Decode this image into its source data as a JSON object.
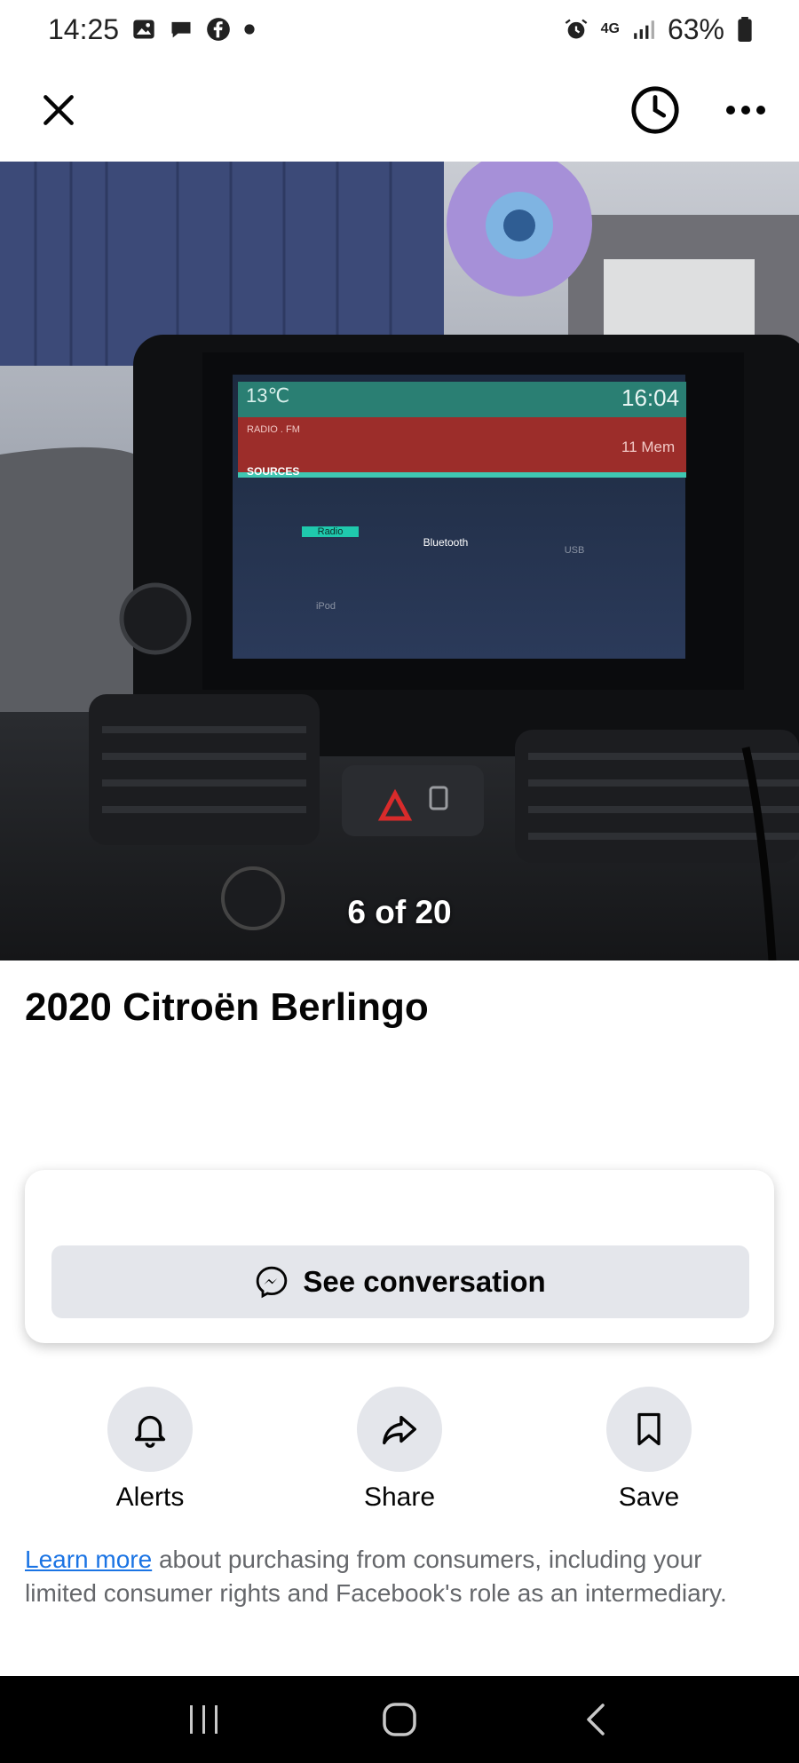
{
  "status_bar": {
    "time": "14:25",
    "network": "4G",
    "battery": "63%",
    "left_icons": [
      "gallery-icon",
      "messages-icon",
      "facebook-icon",
      "dot-icon"
    ],
    "right_icons": [
      "alarm-icon",
      "signal-icon",
      "battery-icon"
    ]
  },
  "app_bar": {
    "close_icon": "close-icon",
    "history_icon": "clock-icon",
    "more_icon": "more-icon"
  },
  "photo": {
    "counter": "6 of 20",
    "screen": {
      "temp": "13℃",
      "clock": "16:04",
      "band": "RADIO . FM",
      "memory": "11 Mem",
      "sources_label": "SOURCES",
      "sources": [
        "Radio",
        "Bluetooth",
        "USB",
        "iPod"
      ]
    }
  },
  "listing": {
    "title": "2020 Citroën Berlingo"
  },
  "card": {
    "see_conversation": "See conversation"
  },
  "actions": [
    {
      "label": "Alerts",
      "icon": "bell-icon"
    },
    {
      "label": "Share",
      "icon": "share-icon"
    },
    {
      "label": "Save",
      "icon": "bookmark-icon"
    }
  ],
  "disclaimer": {
    "link": "Learn more",
    "text": " about purchasing from consumers, including your limited consumer rights and Facebook's role as an intermediary."
  },
  "nav_bar": {
    "items": [
      "recents-icon",
      "home-icon",
      "back-icon"
    ]
  },
  "colors": {
    "link": "#1b74e4",
    "button_bg": "#e4e6eb",
    "nav_bg": "#000000"
  }
}
